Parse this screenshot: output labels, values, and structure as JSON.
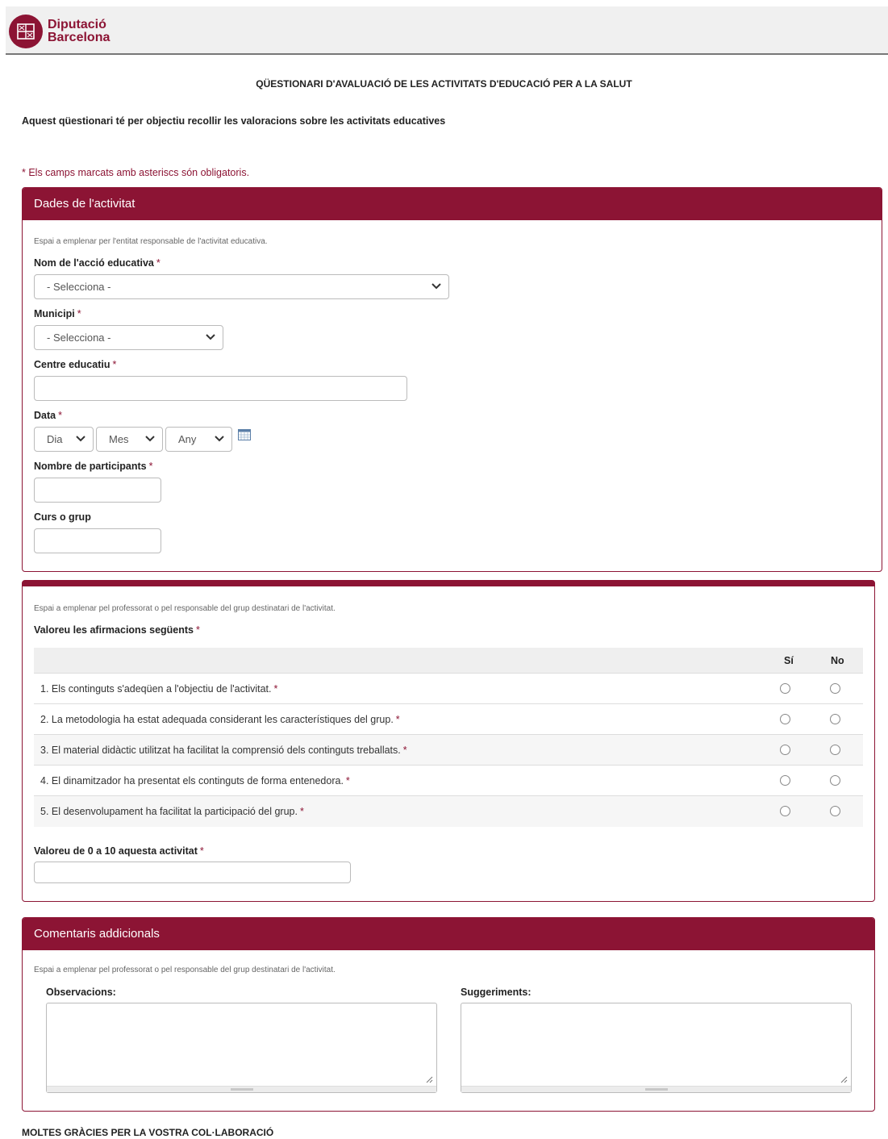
{
  "header": {
    "org_line1": "Diputació",
    "org_line2": "Barcelona"
  },
  "title": "QÜESTIONARI D'AVALUACIÓ DE LES ACTIVITATS D'EDUCACIÓ PER A LA SALUT",
  "intro": "Aquest qüestionari té per objectiu recollir les valoracions sobre les activitats educatives",
  "required_note": "* Els camps marcats amb asteriscs són obligatoris.",
  "activity": {
    "heading": "Dades de l'activitat",
    "help": "Espai a emplenar per l'entitat responsable de l'activitat educativa.",
    "action_label": "Nom de l'acció educativa",
    "action_value": "- Selecciona -",
    "municipality_label": "Municipi",
    "municipality_value": "- Selecciona -",
    "school_label": "Centre educatiu",
    "school_value": "",
    "date_label": "Data",
    "day": "Dia",
    "month": "Mes",
    "year": "Any",
    "participants_label": "Nombre de participants",
    "participants_value": "",
    "course_label": "Curs o grup",
    "course_value": ""
  },
  "evaluation": {
    "help": "Espai a emplenar pel professorat o pel responsable del grup destinatari de l'activitat.",
    "label": "Valoreu les afirmacions següents",
    "col_yes": "Sí",
    "col_no": "No",
    "rows": [
      "1. Els continguts s'adeqüen a l'objectiu de l'activitat.",
      "2. La metodologia ha estat adequada considerant les característiques del grup.",
      "3. El material didàctic utilitzat ha facilitat la comprensió dels continguts treballats.",
      "4. El dinamitzador ha presentat els continguts de forma entenedora.",
      "5. El desenvolupament ha facilitat la participació del grup."
    ],
    "score_label": "Valoreu de 0 a 10 aquesta activitat",
    "score_value": ""
  },
  "comments": {
    "heading": "Comentaris addicionals",
    "help": "Espai a emplenar pel professorat o pel responsable del grup destinatari de l'activitat.",
    "observations_label": "Observacions:",
    "suggestions_label": "Suggeriments:"
  },
  "required_mark": "*",
  "thanks": "MOLTES GRÀCIES PER LA VOSTRA COL·LABORACIÓ",
  "colors": {
    "brand": "#8c1434",
    "border": "#bbbbbb"
  },
  "icons": [
    "diputacio-seal-icon",
    "chevron-down-icon",
    "calendar-icon",
    "resize-grip-icon"
  ]
}
